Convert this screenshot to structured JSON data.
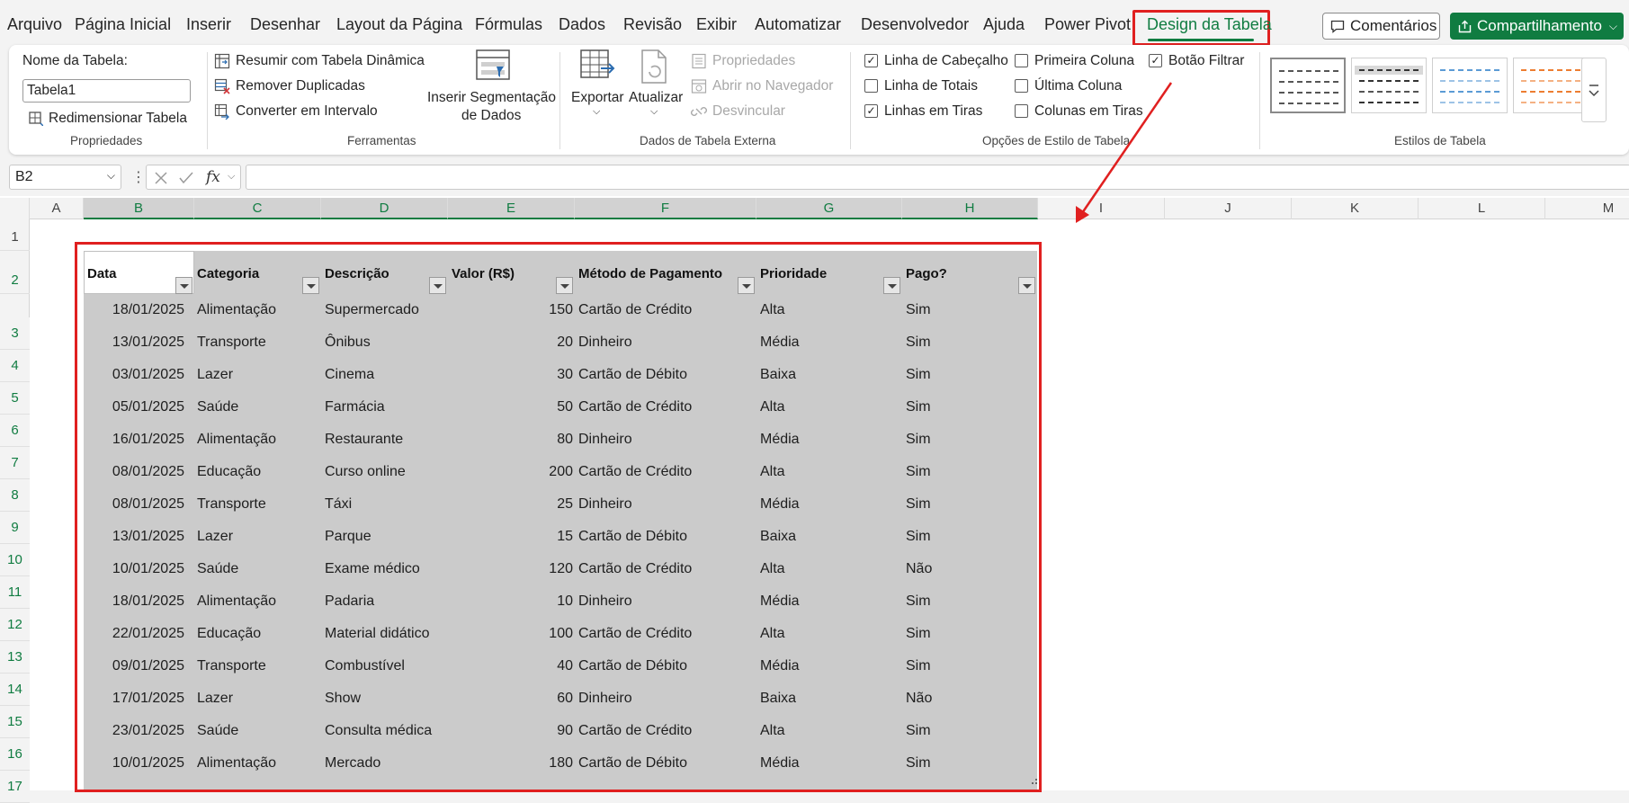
{
  "menu": {
    "tabs": [
      "Arquivo",
      "Página Inicial",
      "Inserir",
      "Desenhar",
      "Layout da Página",
      "Fórmulas",
      "Dados",
      "Revisão",
      "Exibir",
      "Automatizar",
      "Desenvolvedor",
      "Ajuda",
      "Power Pivot",
      "Design da Tabela"
    ],
    "active_tab": "Design da Tabela",
    "comments": "Comentários",
    "share": "Compartilhamento"
  },
  "ribbon": {
    "table_name_label": "Nome da Tabela:",
    "table_name_value": "Tabela1",
    "resize_table": "Redimensionar Tabela",
    "group_properties": "Propriedades",
    "pivot_summary": "Resumir com Tabela Dinâmica",
    "remove_duplicates": "Remover Duplicadas",
    "convert_range": "Converter em Intervalo",
    "slicer_line1": "Inserir Segmentação",
    "slicer_line2": "de Dados",
    "group_tools": "Ferramentas",
    "export": "Exportar",
    "refresh": "Atualizar",
    "properties": "Propriedades",
    "open_browser": "Abrir no Navegador",
    "unlink": "Desvincular",
    "group_external": "Dados de Tabela Externa",
    "opt_header_row": "Linha de Cabeçalho",
    "opt_total_row": "Linha de Totais",
    "opt_banded_rows": "Linhas em Tiras",
    "opt_first_column": "Primeira Coluna",
    "opt_last_column": "Última Coluna",
    "opt_banded_columns": "Colunas em Tiras",
    "opt_filter_button": "Botão Filtrar",
    "group_style_options": "Opções de Estilo de Tabela",
    "group_styles": "Estilos de Tabela",
    "checks": {
      "header_row": true,
      "total_row": false,
      "banded_rows": true,
      "first_column": false,
      "last_column": false,
      "banded_columns": false,
      "filter_button": true
    }
  },
  "formula": {
    "name_box": "B2",
    "content": ""
  },
  "sheet": {
    "columns": [
      "A",
      "B",
      "C",
      "D",
      "E",
      "F",
      "G",
      "H",
      "I",
      "J",
      "K",
      "L",
      "M"
    ],
    "rows": [
      "1",
      "2",
      "3",
      "4",
      "5",
      "6",
      "7",
      "8",
      "9",
      "10",
      "11",
      "12",
      "13",
      "14",
      "15",
      "16",
      "17"
    ]
  },
  "table": {
    "headers": [
      "Data",
      "Categoria",
      "Descrição",
      "Valor (R$)",
      "Método de Pagamento",
      "Prioridade",
      "Pago?"
    ],
    "rows": [
      [
        "18/01/2025",
        "Alimentação",
        "Supermercado",
        "150",
        "Cartão de Crédito",
        "Alta",
        "Sim"
      ],
      [
        "13/01/2025",
        "Transporte",
        "Ônibus",
        "20",
        "Dinheiro",
        "Média",
        "Sim"
      ],
      [
        "03/01/2025",
        "Lazer",
        "Cinema",
        "30",
        "Cartão de Débito",
        "Baixa",
        "Sim"
      ],
      [
        "05/01/2025",
        "Saúde",
        "Farmácia",
        "50",
        "Cartão de Crédito",
        "Alta",
        "Sim"
      ],
      [
        "16/01/2025",
        "Alimentação",
        "Restaurante",
        "80",
        "Dinheiro",
        "Média",
        "Sim"
      ],
      [
        "08/01/2025",
        "Educação",
        "Curso online",
        "200",
        "Cartão de Crédito",
        "Alta",
        "Sim"
      ],
      [
        "08/01/2025",
        "Transporte",
        "Táxi",
        "25",
        "Dinheiro",
        "Média",
        "Sim"
      ],
      [
        "13/01/2025",
        "Lazer",
        "Parque",
        "15",
        "Cartão de Débito",
        "Baixa",
        "Sim"
      ],
      [
        "10/01/2025",
        "Saúde",
        "Exame médico",
        "120",
        "Cartão de Crédito",
        "Alta",
        "Não"
      ],
      [
        "18/01/2025",
        "Alimentação",
        "Padaria",
        "10",
        "Dinheiro",
        "Média",
        "Sim"
      ],
      [
        "22/01/2025",
        "Educação",
        "Material didático",
        "100",
        "Cartão de Crédito",
        "Alta",
        "Sim"
      ],
      [
        "09/01/2025",
        "Transporte",
        "Combustível",
        "40",
        "Cartão de Débito",
        "Média",
        "Sim"
      ],
      [
        "17/01/2025",
        "Lazer",
        "Show",
        "60",
        "Dinheiro",
        "Baixa",
        "Não"
      ],
      [
        "23/01/2025",
        "Saúde",
        "Consulta médica",
        "90",
        "Cartão de Crédito",
        "Alta",
        "Sim"
      ],
      [
        "10/01/2025",
        "Alimentação",
        "Mercado",
        "180",
        "Cartão de Débito",
        "Média",
        "Sim"
      ]
    ]
  },
  "colors": {
    "excel_green": "#107c41",
    "highlight_red": "#e02020",
    "table_fill": "#cbcbcb"
  }
}
